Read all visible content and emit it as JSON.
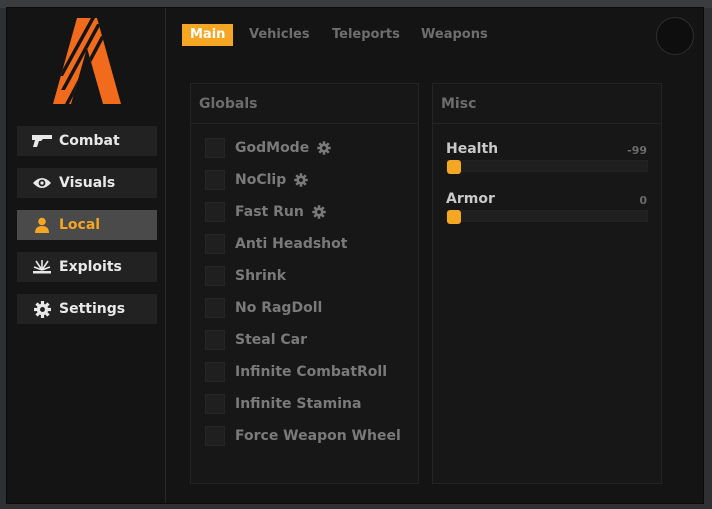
{
  "colors": {
    "accent": "#f5a623",
    "window_bg": "#141414",
    "panel_bg": "#171717",
    "muted_text": "#7a7a7a"
  },
  "sidebar": {
    "logo_icon": "fivem-logo-icon",
    "items": [
      {
        "label": "Combat",
        "icon": "gun-icon",
        "active": false
      },
      {
        "label": "Visuals",
        "icon": "eye-icon",
        "active": false
      },
      {
        "label": "Local",
        "icon": "user-icon",
        "active": true
      },
      {
        "label": "Exploits",
        "icon": "explosion-icon",
        "active": false
      },
      {
        "label": "Settings",
        "icon": "gear-icon",
        "active": false
      }
    ]
  },
  "tabs": [
    {
      "label": "Main",
      "active": true
    },
    {
      "label": "Vehicles",
      "active": false
    },
    {
      "label": "Teleports",
      "active": false
    },
    {
      "label": "Weapons",
      "active": false
    }
  ],
  "globals": {
    "title": "Globals",
    "options": [
      {
        "label": "GodMode",
        "checked": false,
        "has_settings": true
      },
      {
        "label": "NoClip",
        "checked": false,
        "has_settings": true
      },
      {
        "label": "Fast Run",
        "checked": false,
        "has_settings": true
      },
      {
        "label": "Anti Headshot",
        "checked": false,
        "has_settings": false
      },
      {
        "label": "Shrink",
        "checked": false,
        "has_settings": false
      },
      {
        "label": "No RagDoll",
        "checked": false,
        "has_settings": false
      },
      {
        "label": "Steal Car",
        "checked": false,
        "has_settings": false
      },
      {
        "label": "Infinite CombatRoll",
        "checked": false,
        "has_settings": false
      },
      {
        "label": "Infinite Stamina",
        "checked": false,
        "has_settings": false
      },
      {
        "label": "Force Weapon Wheel",
        "checked": false,
        "has_settings": false
      }
    ]
  },
  "misc": {
    "title": "Misc",
    "sliders": [
      {
        "label": "Health",
        "value": "-99",
        "fill_fraction": 0.0
      },
      {
        "label": "Armor",
        "value": "0",
        "fill_fraction": 0.0
      }
    ]
  }
}
